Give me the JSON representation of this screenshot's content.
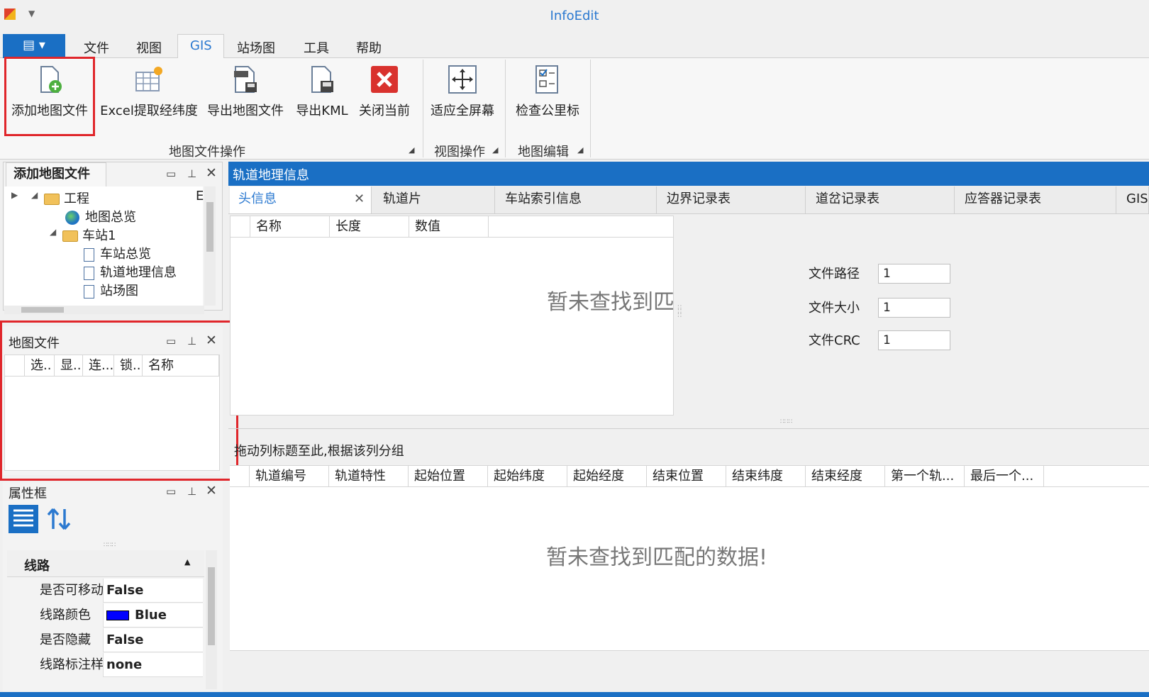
{
  "window": {
    "title": "InfoEdit"
  },
  "menu": {
    "tabs": [
      {
        "label": "文件"
      },
      {
        "label": "视图"
      },
      {
        "label": "GIS"
      },
      {
        "label": "站场图"
      },
      {
        "label": "工具"
      },
      {
        "label": "帮助"
      }
    ]
  },
  "ribbon": {
    "buttons": [
      {
        "label": "添加地图文件"
      },
      {
        "label": "Excel提取经纬度"
      },
      {
        "label": "导出地图文件"
      },
      {
        "label": "导出KML"
      },
      {
        "label": "关闭当前"
      },
      {
        "label": "适应全屏幕"
      },
      {
        "label": "检查公里标"
      }
    ],
    "groups": [
      {
        "label": "地图文件操作"
      },
      {
        "label": "视图操作"
      },
      {
        "label": "地图编辑"
      }
    ]
  },
  "tree_panel": {
    "title": "添加地图文件",
    "extra_char": "E",
    "items": [
      {
        "label": "工程"
      },
      {
        "label": "地图总览"
      },
      {
        "label": "车站1"
      },
      {
        "label": "车站总览"
      },
      {
        "label": "轨道地理信息"
      },
      {
        "label": "站场图"
      }
    ]
  },
  "map_files_panel": {
    "title": "地图文件",
    "columns": [
      "选..",
      "显..",
      "连...",
      "锁..",
      "名称"
    ]
  },
  "props_panel": {
    "title": "属性框",
    "category": "线路",
    "rows": [
      {
        "name": "是否可移动",
        "value": "False"
      },
      {
        "name": "线路颜色",
        "value": "Blue",
        "swatch": "#0000ff"
      },
      {
        "name": "是否隐藏",
        "value": "False"
      },
      {
        "name": "线路标注样",
        "value": "none"
      }
    ]
  },
  "document": {
    "title": "轨道地理信息",
    "tabs": [
      {
        "label": "头信息"
      },
      {
        "label": "轨道片"
      },
      {
        "label": "车站索引信息"
      },
      {
        "label": "边界记录表"
      },
      {
        "label": "道岔记录表"
      },
      {
        "label": "应答器记录表"
      },
      {
        "label": "GIS"
      }
    ],
    "header_grid": {
      "columns": [
        "名称",
        "长度",
        "数值"
      ],
      "empty_text": "暂未查找到匹"
    },
    "fields": [
      {
        "label": "文件路径",
        "value": "1"
      },
      {
        "label": "文件大小",
        "value": "1"
      },
      {
        "label": "文件CRC",
        "value": "1"
      }
    ],
    "group_hint": "拖动列标题至此,根据该列分组",
    "track_grid": {
      "columns": [
        "轨道编号",
        "轨道特性",
        "起始位置",
        "起始纬度",
        "起始经度",
        "结束位置",
        "结束纬度",
        "结束经度",
        "第一个轨...",
        "最后一个..."
      ],
      "empty_text": "暂未查找到匹配的数据!"
    }
  },
  "colors": {
    "accent": "#1a6fc4",
    "highlight": "#e0262b"
  }
}
